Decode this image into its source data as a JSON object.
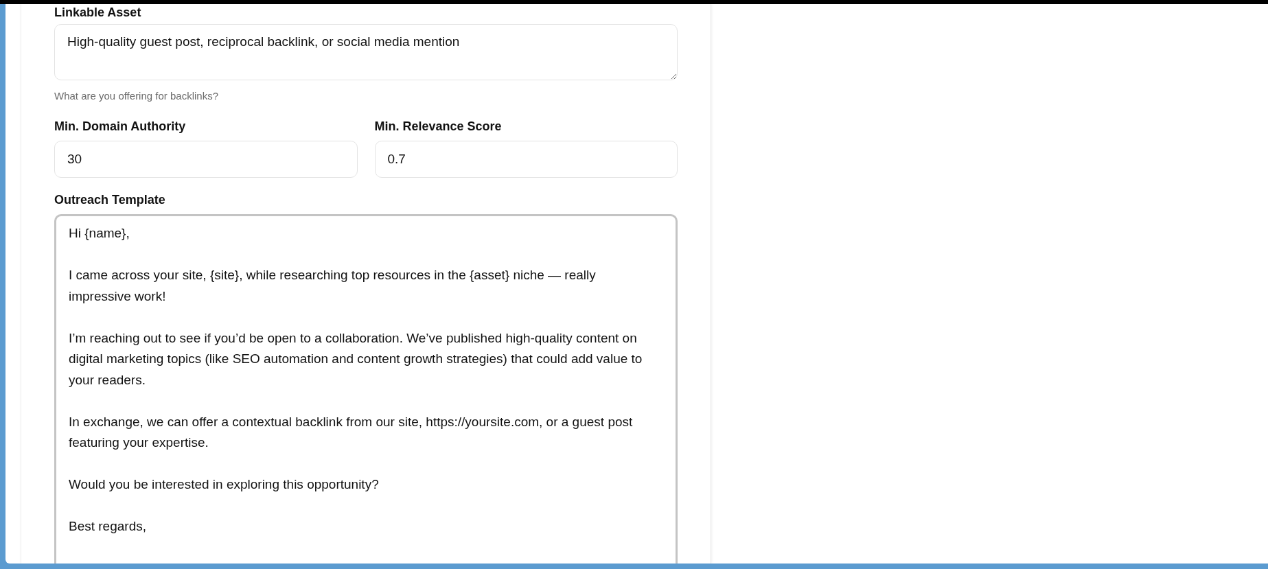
{
  "linkable_asset": {
    "label": "Linkable Asset",
    "value": "High-quality guest post, reciprocal backlink, or social media mention",
    "helper": "What are you offering for backlinks?"
  },
  "thresholds": [
    {
      "label": "Min. Domain Authority",
      "value": "30"
    },
    {
      "label": "Min. Relevance Score",
      "value": "0.7"
    }
  ],
  "outreach_template": {
    "label": "Outreach Template",
    "focused": true,
    "value": "Hi {name},\n\nI came across your site, {site}, while researching top resources in the {asset} niche — really impressive work!\n\nI’m reaching out to see if you’d be open to a collaboration. We’ve published high-quality content on digital marketing topics (like SEO automation and content growth strategies) that could add value to your readers.\n\nIn exchange, we can offer a contextual backlink from our site, https://yoursite.com, or a guest post featuring your expertise.\n\nWould you be interested in exploring this opportunity?\n\nBest regards,"
  }
}
